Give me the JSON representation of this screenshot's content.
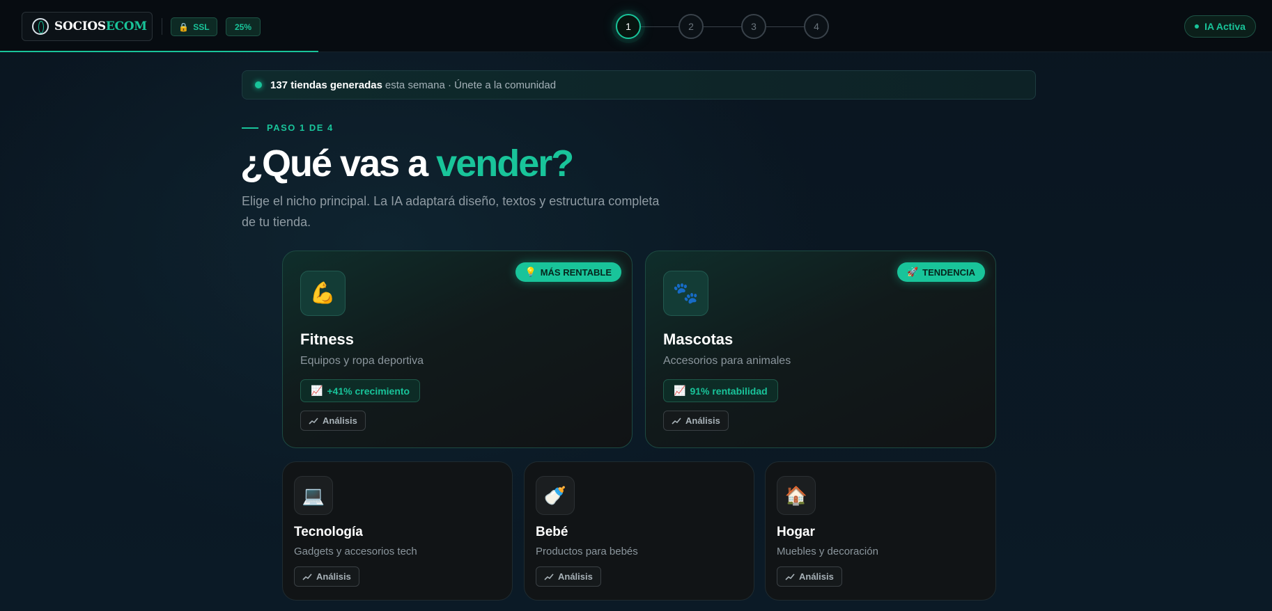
{
  "header": {
    "logo_part1": "SOCIOS",
    "logo_part2": "ECOM",
    "ssl_label": "SSL",
    "progress_label": "25%",
    "steps": [
      "1",
      "2",
      "3",
      "4"
    ],
    "active_step": 1,
    "ia_status": "IA Activa",
    "progress": 0.25
  },
  "banner": {
    "strong": "137 tiendas generadas",
    "rest": "esta semana · Únete a la comunidad"
  },
  "intro": {
    "eyebrow": "PASO 1 DE 4",
    "title_main": "¿Qué vas a ",
    "title_accent": "vender?",
    "subtitle": "Elige el nicho principal. La IA adaptará diseño, textos y estructura completa de tu tienda."
  },
  "niches": {
    "fitness": {
      "icon": "💪",
      "name": "Fitness",
      "desc": "Equipos y ropa deportiva",
      "badge_icon": "💡",
      "badge": "MÁS RENTABLE",
      "metric_icon": "📈",
      "metric": "+41% crecimiento",
      "analysis": "Análisis"
    },
    "mascotas": {
      "icon": "🐾",
      "name": "Mascotas",
      "desc": "Accesorios para animales",
      "badge_icon": "🚀",
      "badge": "TENDENCIA",
      "metric_icon": "📈",
      "metric": "91% rentabilidad",
      "analysis": "Análisis"
    },
    "tecnologia": {
      "icon": "💻",
      "name": "Tecnología",
      "desc": "Gadgets y accesorios tech",
      "analysis": "Análisis"
    },
    "bebe": {
      "icon": "🍼",
      "name": "Bebé",
      "desc": "Productos para bebés",
      "analysis": "Análisis"
    },
    "hogar": {
      "icon": "🏠",
      "name": "Hogar",
      "desc": "Muebles y decoración",
      "analysis": "Análisis"
    }
  },
  "colors": {
    "accent": "#19c49a",
    "background": "#0b1620",
    "card": "#111416"
  }
}
